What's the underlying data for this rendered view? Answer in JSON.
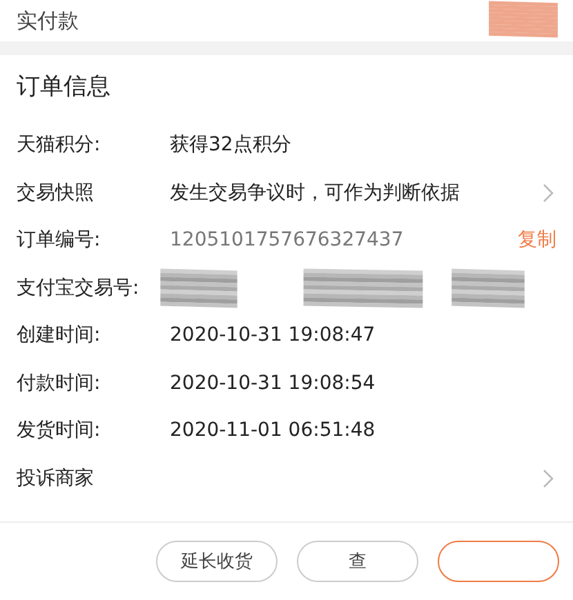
{
  "top_section": {
    "label": "实付款"
  },
  "order_info": {
    "title": "订单信息",
    "rows": [
      {
        "kind": "text",
        "label": "天猫积分:",
        "value": "获得32点积分"
      },
      {
        "kind": "link",
        "label": "交易快照",
        "value": "发生交易争议时，可作为判断依据"
      },
      {
        "kind": "copy",
        "label": "订单编号:",
        "value": "1205101757676327437",
        "action": "复制"
      },
      {
        "kind": "redacted",
        "label": "支付宝交易号:"
      },
      {
        "kind": "text",
        "label": "创建时间:",
        "value": "2020-10-31 19:08:47"
      },
      {
        "kind": "text",
        "label": "付款时间:",
        "value": "2020-10-31 19:08:54"
      },
      {
        "kind": "text",
        "label": "发货时间:",
        "value": "2020-11-01 06:51:48"
      },
      {
        "kind": "link",
        "label": "投诉商家"
      }
    ]
  },
  "buttons": [
    {
      "kind": "plain",
      "label": "延长收货"
    },
    {
      "kind": "plain",
      "label": "查"
    },
    {
      "kind": "primary"
    }
  ]
}
